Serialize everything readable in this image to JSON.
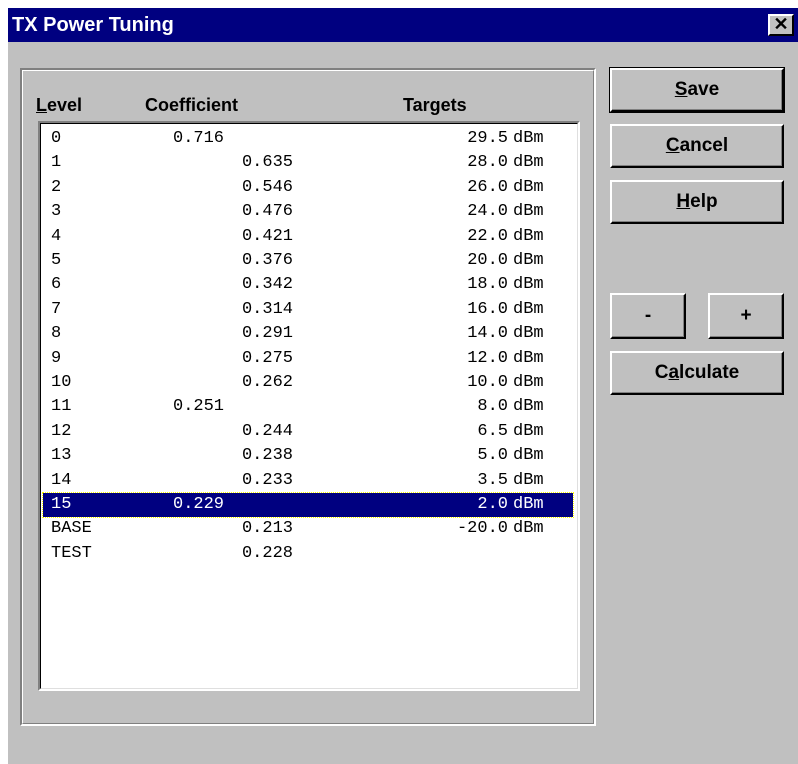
{
  "window": {
    "title": "TX Power Tuning",
    "close_glyph": "✕"
  },
  "table": {
    "headers": {
      "level_accel": "L",
      "level_rest": "evel",
      "coefficient": "Coefficient",
      "targets": "Targets"
    },
    "rows": [
      {
        "level": "0",
        "coefficient": "0.716",
        "target": "29.5",
        "unit": "dBm"
      },
      {
        "level": "1",
        "coefficient": "0.635",
        "target": "28.0",
        "unit": "dBm"
      },
      {
        "level": "2",
        "coefficient": "0.546",
        "target": "26.0",
        "unit": "dBm"
      },
      {
        "level": "3",
        "coefficient": "0.476",
        "target": "24.0",
        "unit": "dBm"
      },
      {
        "level": "4",
        "coefficient": "0.421",
        "target": "22.0",
        "unit": "dBm"
      },
      {
        "level": "5",
        "coefficient": "0.376",
        "target": "20.0",
        "unit": "dBm"
      },
      {
        "level": "6",
        "coefficient": "0.342",
        "target": "18.0",
        "unit": "dBm"
      },
      {
        "level": "7",
        "coefficient": "0.314",
        "target": "16.0",
        "unit": "dBm"
      },
      {
        "level": "8",
        "coefficient": "0.291",
        "target": "14.0",
        "unit": "dBm"
      },
      {
        "level": "9",
        "coefficient": "0.275",
        "target": "12.0",
        "unit": "dBm"
      },
      {
        "level": "10",
        "coefficient": "0.262",
        "target": "10.0",
        "unit": "dBm"
      },
      {
        "level": "11",
        "coefficient": "0.251",
        "target": "8.0",
        "unit": "dBm"
      },
      {
        "level": "12",
        "coefficient": "0.244",
        "target": "6.5",
        "unit": "dBm"
      },
      {
        "level": "13",
        "coefficient": "0.238",
        "target": "5.0",
        "unit": "dBm"
      },
      {
        "level": "14",
        "coefficient": "0.233",
        "target": "3.5",
        "unit": "dBm"
      },
      {
        "level": "15",
        "coefficient": "0.229",
        "target": "2.0",
        "unit": "dBm"
      },
      {
        "level": "BASE",
        "coefficient": "0.213",
        "target": "-20.0",
        "unit": "dBm"
      },
      {
        "level": "TEST",
        "coefficient": "0.228",
        "target": "",
        "unit": ""
      }
    ],
    "selected_row": "15"
  },
  "buttons": {
    "save": {
      "accel": "S",
      "rest": "ave"
    },
    "cancel": {
      "accel": "C",
      "rest": "ancel"
    },
    "help": {
      "accel": "H",
      "rest": "elp"
    },
    "minus": {
      "label": "-"
    },
    "plus": {
      "label": "+"
    },
    "calculate": {
      "pre": "C",
      "accel": "a",
      "rest": "lculate"
    }
  },
  "colors": {
    "titlebar": "#000080",
    "face": "#c0c0c0",
    "selection": "#000080"
  }
}
